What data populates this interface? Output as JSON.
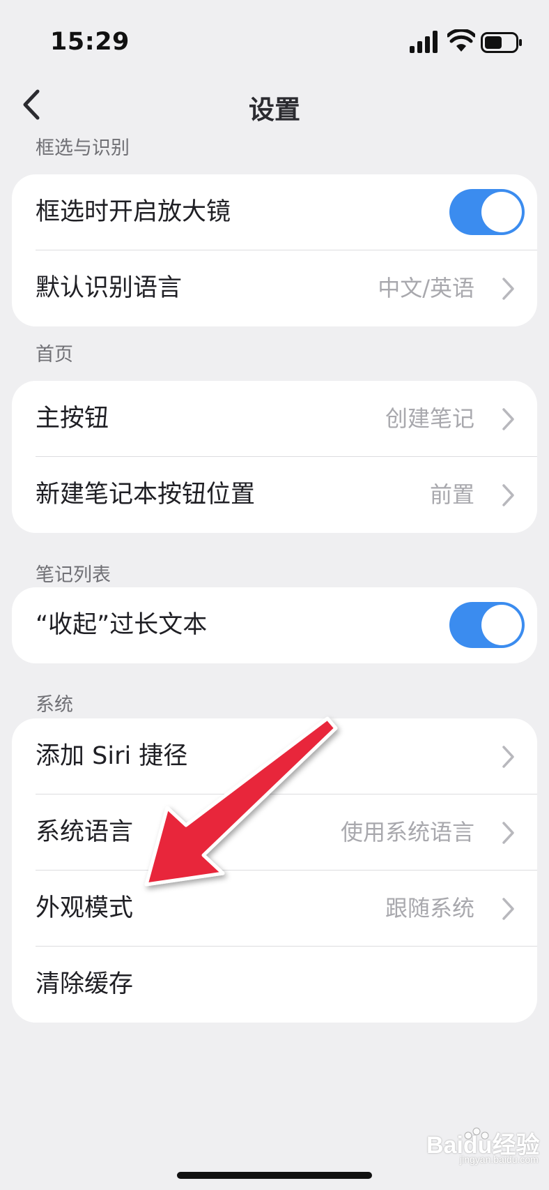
{
  "status_bar": {
    "time": "15:29"
  },
  "nav": {
    "title": "设置"
  },
  "sections": {
    "selection": {
      "header": "框选与识别",
      "magnifier_label": "框选时开启放大镜",
      "magnifier_on": true,
      "language_label": "默认识别语言",
      "language_value": "中文/英语"
    },
    "home": {
      "header": "首页",
      "main_button_label": "主按钮",
      "main_button_value": "创建笔记",
      "new_notebook_label": "新建笔记本按钮位置",
      "new_notebook_value": "前置"
    },
    "note_list": {
      "header": "笔记列表",
      "collapse_label": "“收起”过长文本",
      "collapse_on": true
    },
    "system": {
      "header": "系统",
      "siri_label": "添加 Siri 捷径",
      "language_label": "系统语言",
      "language_value": "使用系统语言",
      "appearance_label": "外观模式",
      "appearance_value": "跟随系统",
      "clear_cache_label": "清除缓存"
    }
  },
  "colors": {
    "accent_toggle": "#3b8cef",
    "annotation_arrow": "#e8273b",
    "background": "#efeff1"
  },
  "watermark": {
    "text": "Baidu经验",
    "sub": "jingyan.baidu.com"
  }
}
